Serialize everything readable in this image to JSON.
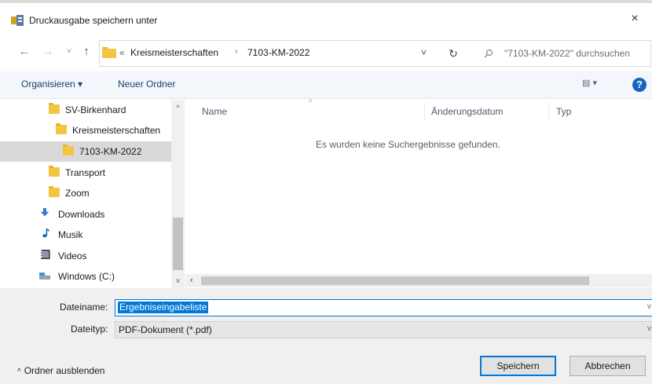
{
  "window": {
    "title": "Druckausgabe speichern unter",
    "close_glyph": "×"
  },
  "nav": {
    "back_glyph": "←",
    "forward_glyph": "→",
    "recent_glyph": "˅",
    "up_glyph": "↑",
    "address": {
      "overflow": "«",
      "crumbs": [
        "Kreismeisterschaften",
        "7103-KM-2022"
      ],
      "separator": "›",
      "dropdown_glyph": "˅",
      "refresh_glyph": "↻"
    },
    "search": {
      "icon": "search-icon",
      "placeholder": "\"7103-KM-2022\" durchsuchen"
    }
  },
  "toolbar": {
    "organize": "Organisieren ▾",
    "new_folder": "Neuer Ordner",
    "view_glyph": "▤ ▾",
    "help": "?"
  },
  "tree": [
    {
      "label": "SV-Birkenhard",
      "icon": "folder-icon",
      "indent": 1
    },
    {
      "label": "Kreismeisterschaften",
      "icon": "folder-icon",
      "indent": 2
    },
    {
      "label": "7103-KM-2022",
      "icon": "folder-icon",
      "indent": 3,
      "selected": true
    },
    {
      "label": "Transport",
      "icon": "folder-icon",
      "indent": 1
    },
    {
      "label": "Zoom",
      "icon": "folder-icon",
      "indent": 1
    },
    {
      "label": "Downloads",
      "icon": "download-icon",
      "indent": 0
    },
    {
      "label": "Musik",
      "icon": "music-icon",
      "indent": 0
    },
    {
      "label": "Videos",
      "icon": "video-icon",
      "indent": 0
    },
    {
      "label": "Windows (C:)",
      "icon": "drive-icon",
      "indent": 0
    }
  ],
  "content": {
    "columns": [
      "Name",
      "Änderungsdatum",
      "Typ"
    ],
    "empty_message": "Es wurden keine Suchergebnisse gefunden."
  },
  "form": {
    "filename_label": "Dateiname:",
    "filename_value": "Ergebniseingabeliste",
    "filetype_label": "Dateityp:",
    "filetype_value": "PDF-Dokument (*.pdf)"
  },
  "footer": {
    "hide_folders": "Ordner ausblenden",
    "save": "Speichern",
    "cancel": "Abbrechen"
  }
}
